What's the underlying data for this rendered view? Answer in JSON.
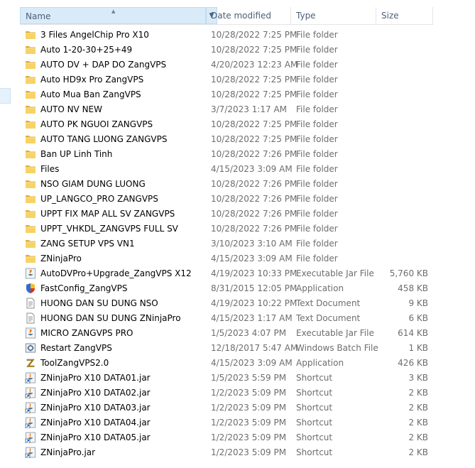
{
  "columns": {
    "name": "Name",
    "date": "Date modified",
    "type": "Type",
    "size": "Size"
  },
  "files": [
    {
      "name": "3 Files AngelChip Pro X10",
      "date": "10/28/2022 7:25 PM",
      "type": "File folder",
      "size": "",
      "icon": "folder-icon"
    },
    {
      "name": "Auto 1-20-30+25+49",
      "date": "10/28/2022 7:25 PM",
      "type": "File folder",
      "size": "",
      "icon": "folder-icon"
    },
    {
      "name": "AUTO DV + DAP DO ZangVPS",
      "date": "4/20/2023 12:23 AM",
      "type": "File folder",
      "size": "",
      "icon": "folder-icon"
    },
    {
      "name": "Auto HD9x Pro ZangVPS",
      "date": "10/28/2022 7:25 PM",
      "type": "File folder",
      "size": "",
      "icon": "folder-icon"
    },
    {
      "name": "Auto Mua Ban ZangVPS",
      "date": "10/28/2022 7:25 PM",
      "type": "File folder",
      "size": "",
      "icon": "folder-icon"
    },
    {
      "name": "AUTO NV NEW",
      "date": "3/7/2023 1:17 AM",
      "type": "File folder",
      "size": "",
      "icon": "folder-icon"
    },
    {
      "name": "AUTO PK NGUOI ZANGVPS",
      "date": "10/28/2022 7:25 PM",
      "type": "File folder",
      "size": "",
      "icon": "folder-icon"
    },
    {
      "name": "AUTO TANG LUONG ZANGVPS",
      "date": "10/28/2022 7:25 PM",
      "type": "File folder",
      "size": "",
      "icon": "folder-icon"
    },
    {
      "name": "Ban UP Linh Tinh",
      "date": "10/28/2022 7:26 PM",
      "type": "File folder",
      "size": "",
      "icon": "folder-icon"
    },
    {
      "name": "Files",
      "date": "4/15/2023 3:09 AM",
      "type": "File folder",
      "size": "",
      "icon": "folder-icon"
    },
    {
      "name": "NSO GIAM DUNG LUONG",
      "date": "10/28/2022 7:26 PM",
      "type": "File folder",
      "size": "",
      "icon": "folder-icon"
    },
    {
      "name": "UP_LANGCO_PRO ZANGVPS",
      "date": "10/28/2022 7:26 PM",
      "type": "File folder",
      "size": "",
      "icon": "folder-icon"
    },
    {
      "name": "UPPT FIX MAP ALL SV ZANGVPS",
      "date": "10/28/2022 7:26 PM",
      "type": "File folder",
      "size": "",
      "icon": "folder-icon"
    },
    {
      "name": "UPPT_VHKDL_ZANGVPS FULL SV",
      "date": "10/28/2022 7:26 PM",
      "type": "File folder",
      "size": "",
      "icon": "folder-icon"
    },
    {
      "name": "ZANG SETUP VPS VN1",
      "date": "3/10/2023 3:10 AM",
      "type": "File folder",
      "size": "",
      "icon": "folder-icon"
    },
    {
      "name": "ZNinjaPro",
      "date": "4/15/2023 3:09 AM",
      "type": "File folder",
      "size": "",
      "icon": "folder-icon"
    },
    {
      "name": "AutoDVPro+Upgrade_ZangVPS  X12",
      "date": "4/19/2023 10:33 PM",
      "type": "Executable Jar File",
      "size": "5,760 KB",
      "icon": "jar-icon"
    },
    {
      "name": "FastConfig_ZangVPS",
      "date": "8/31/2015 12:05 PM",
      "type": "Application",
      "size": "458 KB",
      "icon": "shield-app-icon"
    },
    {
      "name": "HUONG DAN SU DUNG NSO",
      "date": "4/19/2023 10:22 PM",
      "type": "Text Document",
      "size": "9 KB",
      "icon": "text-document-icon"
    },
    {
      "name": "HUONG DAN SU DUNG ZNinjaPro",
      "date": "4/15/2023 1:17 AM",
      "type": "Text Document",
      "size": "6 KB",
      "icon": "text-document-icon"
    },
    {
      "name": "MICRO ZANGVPS PRO",
      "date": "1/5/2023 4:07 PM",
      "type": "Executable Jar File",
      "size": "614 KB",
      "icon": "jar-icon"
    },
    {
      "name": "Restart  ZangVPS",
      "date": "12/18/2017 5:47 AM",
      "type": "Windows Batch File",
      "size": "1 KB",
      "icon": "batch-file-icon"
    },
    {
      "name": "ToolZangVPS2.0",
      "date": "4/15/2023 3:09 AM",
      "type": "Application",
      "size": "426 KB",
      "icon": "z-app-icon"
    },
    {
      "name": "ZNinjaPro X10 DATA01.jar",
      "date": "1/5/2023 5:59 PM",
      "type": "Shortcut",
      "size": "3 KB",
      "icon": "java-shortcut-icon"
    },
    {
      "name": "ZNinjaPro X10 DATA02.jar",
      "date": "1/2/2023 5:09 PM",
      "type": "Shortcut",
      "size": "2 KB",
      "icon": "java-shortcut-icon"
    },
    {
      "name": "ZNinjaPro X10 DATA03.jar",
      "date": "1/2/2023 5:09 PM",
      "type": "Shortcut",
      "size": "2 KB",
      "icon": "java-shortcut-icon"
    },
    {
      "name": "ZNinjaPro X10 DATA04.jar",
      "date": "1/2/2023 5:09 PM",
      "type": "Shortcut",
      "size": "2 KB",
      "icon": "java-shortcut-icon"
    },
    {
      "name": "ZNinjaPro X10 DATA05.jar",
      "date": "1/2/2023 5:09 PM",
      "type": "Shortcut",
      "size": "2 KB",
      "icon": "java-shortcut-icon"
    },
    {
      "name": "ZNinjaPro.jar",
      "date": "1/2/2023 5:09 PM",
      "type": "Shortcut",
      "size": "2 KB",
      "icon": "java-shortcut-icon"
    }
  ],
  "colors": {
    "header_selected_bg": "#d9ebf9",
    "header_text": "#4c607a",
    "detail_text": "#6d6d6d",
    "folder_yellow": "#f3c84a"
  }
}
